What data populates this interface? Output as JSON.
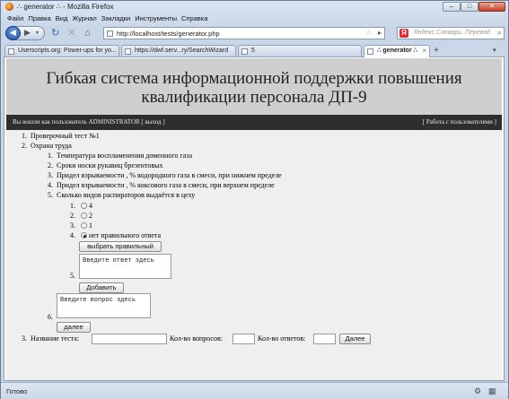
{
  "window": {
    "title": "∴ generator ∴ - Mozilla Firefox",
    "min_label": "–",
    "max_label": "□",
    "close_label": "✕"
  },
  "menu": [
    "Файл",
    "Правка",
    "Вид",
    "Журнал",
    "Закладки",
    "Инструменты",
    "Справка"
  ],
  "nav": {
    "back_glyph": "◀",
    "forward_glyph": "▶",
    "dropdown_glyph": "▾",
    "reload_glyph": "↻",
    "stop_glyph": "✕",
    "home_glyph": "⌂",
    "url": "http://localhost/tests/generator.php",
    "star_glyph": "☆",
    "go_glyph": "▸",
    "search_logo": "Я",
    "search_placeholder": "Яндекс.Словари. Перевод",
    "search_glyph": "⌕"
  },
  "tabs": [
    {
      "label": "Userscripts.org: Power-ups for yo...",
      "active": false
    },
    {
      "label": "https://dwf.serv...ry/SearchWizard",
      "active": false
    },
    {
      "label": "5",
      "active": false
    },
    {
      "label": "∴ generator ∴",
      "active": true
    }
  ],
  "tab_close_glyph": "×",
  "newtab_glyph": "+",
  "tablist_glyph": "▾",
  "page": {
    "title": "Гибкая система информационной поддержки повышения квалификации персонала ДП-9",
    "login_prefix": "Вы вошли как пользователь",
    "username": "ADMINISTRATOR",
    "logout_link": "[ выход ]",
    "users_link": "[ Работа с пользователями ]"
  },
  "tests": [
    {
      "num": "1.",
      "name": "Проверочный тест №1"
    },
    {
      "num": "2.",
      "name": "Охрана труда"
    },
    {
      "num": "3.",
      "name": "Название теста:"
    }
  ],
  "questions": [
    {
      "num": "1.",
      "text": "Температура воспламенения доменного газа"
    },
    {
      "num": "2.",
      "text": "Сроки носки рукавиц брезентовых"
    },
    {
      "num": "3.",
      "text": "Придел взрываемости , % водородного газа в смеси, при нижнем пределе"
    },
    {
      "num": "4.",
      "text": "Придел взрываемости , % коксового газа в смеси, при верхнем пределе"
    },
    {
      "num": "5.",
      "text": "Сколько видов распираторов выдаётся в цеху"
    },
    {
      "num": "6."
    }
  ],
  "answers": [
    {
      "num": "1.",
      "text": "4",
      "checked": false
    },
    {
      "num": "2.",
      "text": "2",
      "checked": false
    },
    {
      "num": "3.",
      "text": "1",
      "checked": false
    },
    {
      "num": "4.",
      "text": "нет правильного ответа",
      "checked": true
    },
    {
      "num": "5."
    }
  ],
  "form": {
    "choose_correct_label": "выбрать правильный",
    "answer_placeholder": "Введите ответ здесь",
    "add_label": "Добавить",
    "question_placeholder": "Введите вопрос здесь",
    "next_label": "далее",
    "questions_count_label": "Кол-во вопросов:",
    "answers_count_label": "Кол-во ответов:",
    "submit_label": "Далее"
  },
  "status": {
    "text": "Готово"
  }
}
